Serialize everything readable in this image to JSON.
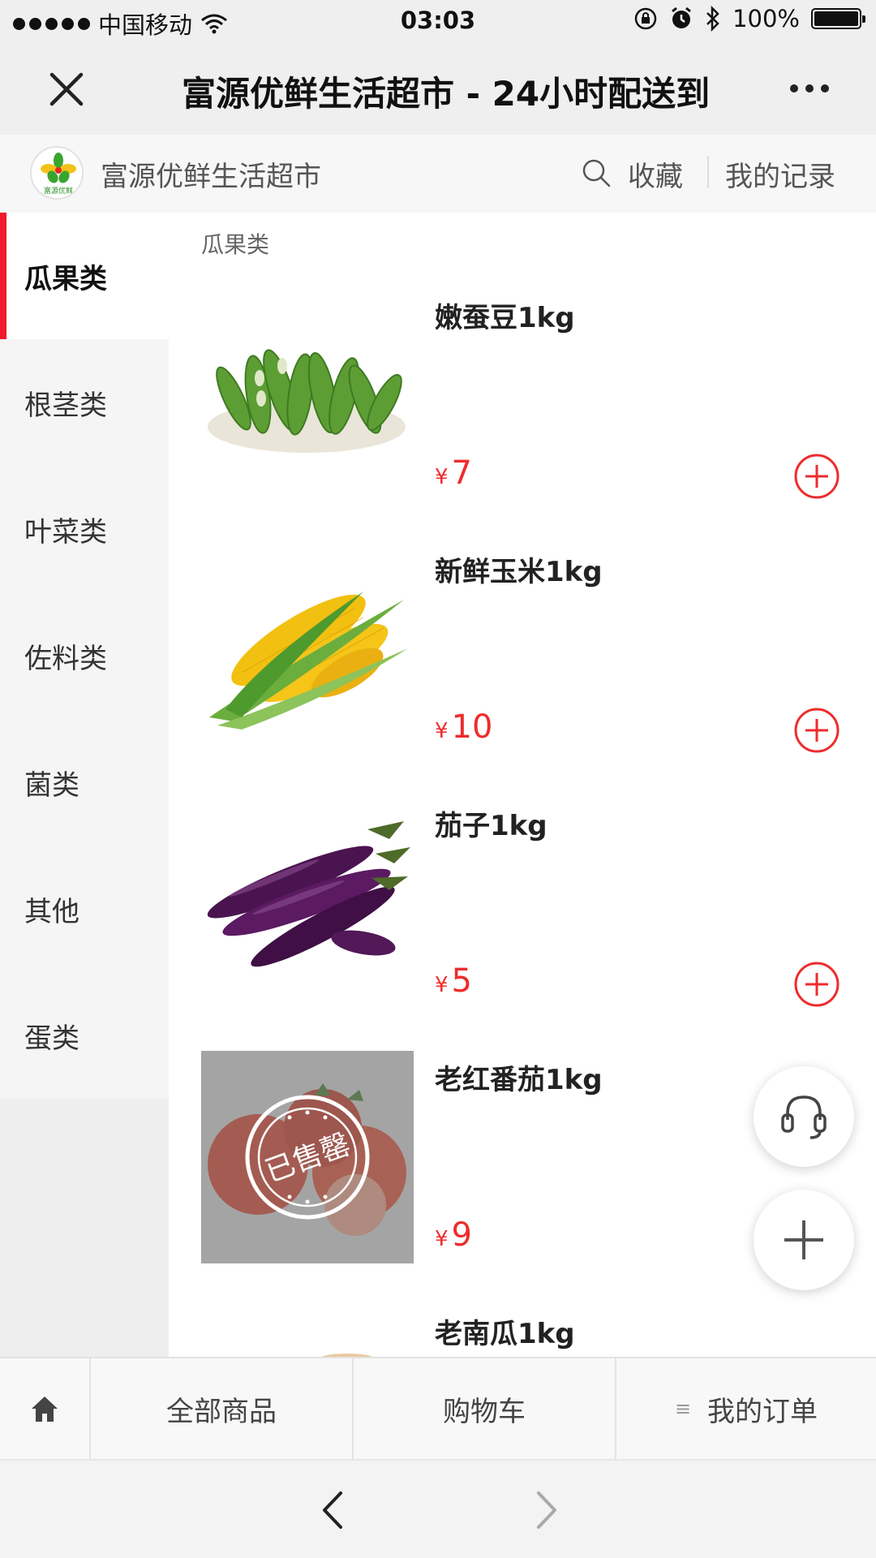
{
  "status_bar": {
    "carrier": "中国移动",
    "time": "03:03",
    "battery": "100%"
  },
  "nav": {
    "title": "富源优鲜生活超市 - 24小时配送到"
  },
  "shop": {
    "logo_text": "富源优鲜",
    "name": "富源优鲜生活超市",
    "favorite_label": "收藏",
    "records_label": "我的记录"
  },
  "categories": [
    {
      "label": "瓜果类"
    },
    {
      "label": "根茎类"
    },
    {
      "label": "叶菜类"
    },
    {
      "label": "佐料类"
    },
    {
      "label": "菌类"
    },
    {
      "label": "其他"
    },
    {
      "label": "蛋类"
    }
  ],
  "section_title": "瓜果类",
  "products": [
    {
      "name": "嫩蚕豆1kg",
      "currency": "¥",
      "price": "7"
    },
    {
      "name": "新鲜玉米1kg",
      "currency": "¥",
      "price": "10"
    },
    {
      "name": "茄子1kg",
      "currency": "¥",
      "price": "5"
    },
    {
      "name": "老红番茄1kg",
      "currency": "¥",
      "price": "9",
      "stamp": "已售罄"
    },
    {
      "name": "老南瓜1kg"
    }
  ],
  "tabbar": {
    "all_products": "全部商品",
    "cart": "购物车",
    "orders": "我的订单"
  },
  "theme": {
    "accent": "#ee1a2c",
    "price": "#ee2c2c"
  }
}
